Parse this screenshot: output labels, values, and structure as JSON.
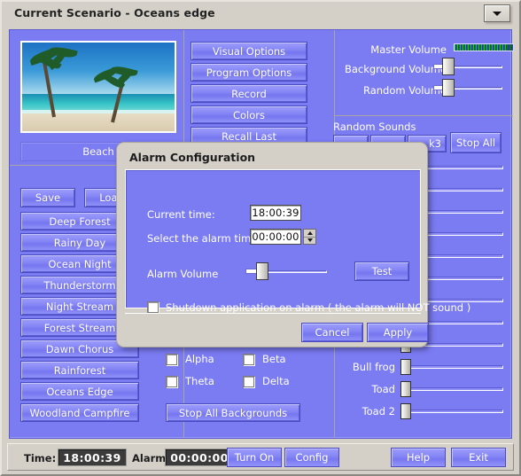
{
  "window": {
    "title": "Current Scenario - Oceans edge",
    "dropdown_icon": "chevron-down-icon"
  },
  "scenario": {
    "image_caption": "Beach"
  },
  "actions": {
    "save_label": "Save",
    "load_label": "Load"
  },
  "scenario_list": [
    "Deep Forest",
    "Rainy Day",
    "Ocean Night",
    "Thunderstorm",
    "Night Stream",
    "Forest Stream",
    "Dawn Chorus",
    "Rainforest",
    "Oceans Edge",
    "Woodland Campfire"
  ],
  "options_buttons": [
    "Visual Options",
    "Program Options",
    "Record",
    "Colors",
    "Recall Last"
  ],
  "volumes": {
    "master_label": "Master Volume",
    "master_segments": 22,
    "master_lit": 20,
    "background_label": "Background Volume",
    "background_value": 12,
    "random_label": "Random Volume",
    "random_value": 12
  },
  "random_sounds": {
    "group_label": "Random Sounds",
    "track3_label": "k3",
    "stop_all_label": "Stop All"
  },
  "sound_sliders": [
    {
      "label": "",
      "value": 0
    },
    {
      "label": "",
      "value": 0
    },
    {
      "label": "",
      "value": 0
    },
    {
      "label": "",
      "value": 0
    },
    {
      "label": "",
      "value": 0
    },
    {
      "label": "",
      "value": 0
    },
    {
      "label": "",
      "value": 0
    },
    {
      "label": "",
      "value": 0
    },
    {
      "label": "",
      "value": 0
    },
    {
      "label": "Bull frog",
      "value": 0
    },
    {
      "label": "Toad",
      "value": 0
    },
    {
      "label": "Toad 2",
      "value": 0
    }
  ],
  "wave_checkboxes": [
    {
      "label": "Alpha",
      "checked": false
    },
    {
      "label": "Beta",
      "checked": false
    },
    {
      "label": "Theta",
      "checked": false
    },
    {
      "label": "Delta",
      "checked": false
    }
  ],
  "stop_backgrounds_label": "Stop All Backgrounds",
  "dialog": {
    "title": "Alarm Configuration",
    "current_time_label": "Current time:",
    "current_time_value": "18:00:39",
    "alarm_time_label": "Select the alarm time",
    "alarm_time_value": "00:00:00",
    "alarm_volume_label": "Alarm Volume",
    "alarm_volume_value": 14,
    "test_label": "Test",
    "shutdown_label": "Shutdown application on alarm ( the alarm will NOT sound )",
    "shutdown_checked": false,
    "cancel_label": "Cancel",
    "apply_label": "Apply"
  },
  "statusbar": {
    "time_label": "Time:",
    "time_value": "18:00:39",
    "alarm_label": "Alarm:",
    "alarm_value": "00:00:00",
    "turn_on_label": "Turn On",
    "config_label": "Config",
    "help_label": "Help",
    "exit_label": "Exit"
  }
}
